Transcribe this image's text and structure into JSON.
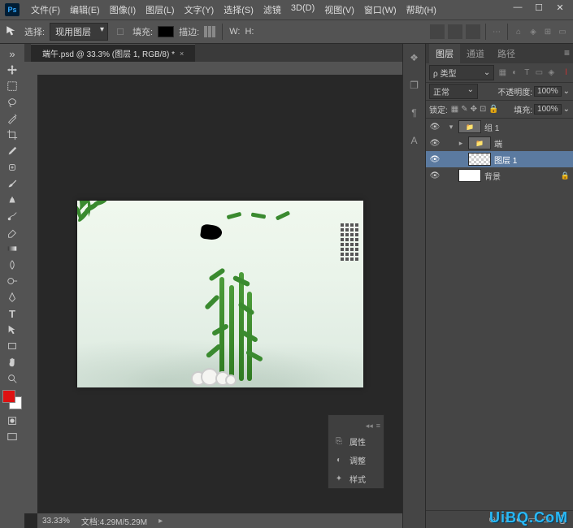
{
  "app": {
    "ps_icon": "Ps",
    "menu": [
      "文件(F)",
      "编辑(E)",
      "图像(I)",
      "图层(L)",
      "文字(Y)",
      "选择(S)",
      "滤镜",
      "3D(D)",
      "视图(V)",
      "窗口(W)",
      "帮助(H)"
    ]
  },
  "options": {
    "select_label": "选择:",
    "select_value": "现用图层",
    "fill_label": "填充:",
    "stroke_label": "描边:",
    "group_w_label": "W:",
    "group_h_label": "H:",
    "icons": [
      "对齐",
      "分布"
    ]
  },
  "document": {
    "tab_title": "端午.psd @ 33.3% (图层 1, RGB/8) *",
    "zoom": "33.33%",
    "doc_size": "文档:4.29M/5.29M"
  },
  "floating_panel": {
    "items": [
      {
        "icon": "⎘",
        "label": "属性"
      },
      {
        "icon": "◐",
        "label": "调整"
      },
      {
        "icon": "✦",
        "label": "样式"
      }
    ]
  },
  "collapsed_dock": [
    "❖",
    "❐",
    "¶",
    "A"
  ],
  "layers_panel": {
    "tabs": [
      "图层",
      "通道",
      "路径"
    ],
    "filter_kind": "ρ 类型",
    "blend_mode": "正常",
    "opacity_label": "不透明度:",
    "opacity_value": "100%",
    "lock_label": "锁定:",
    "fill_label": "填充:",
    "fill_value": "100%",
    "layers": [
      {
        "vis": true,
        "disclosure": "▾",
        "indent": 0,
        "thumb": "folder",
        "name": "组 1",
        "selected": false
      },
      {
        "vis": true,
        "disclosure": "▸",
        "indent": 1,
        "thumb": "folder",
        "name": "端",
        "selected": false
      },
      {
        "vis": true,
        "disclosure": "",
        "indent": 1,
        "thumb": "checker",
        "name": "图层 1",
        "selected": true
      },
      {
        "vis": true,
        "disclosure": "",
        "indent": 0,
        "thumb": "bg",
        "name": "背景",
        "selected": false,
        "locked": true
      }
    ],
    "footer_icons": [
      "⊕",
      "fx",
      "◐",
      "▭",
      "⊡",
      "🗑"
    ]
  },
  "watermark": "UiBQ.CoM"
}
